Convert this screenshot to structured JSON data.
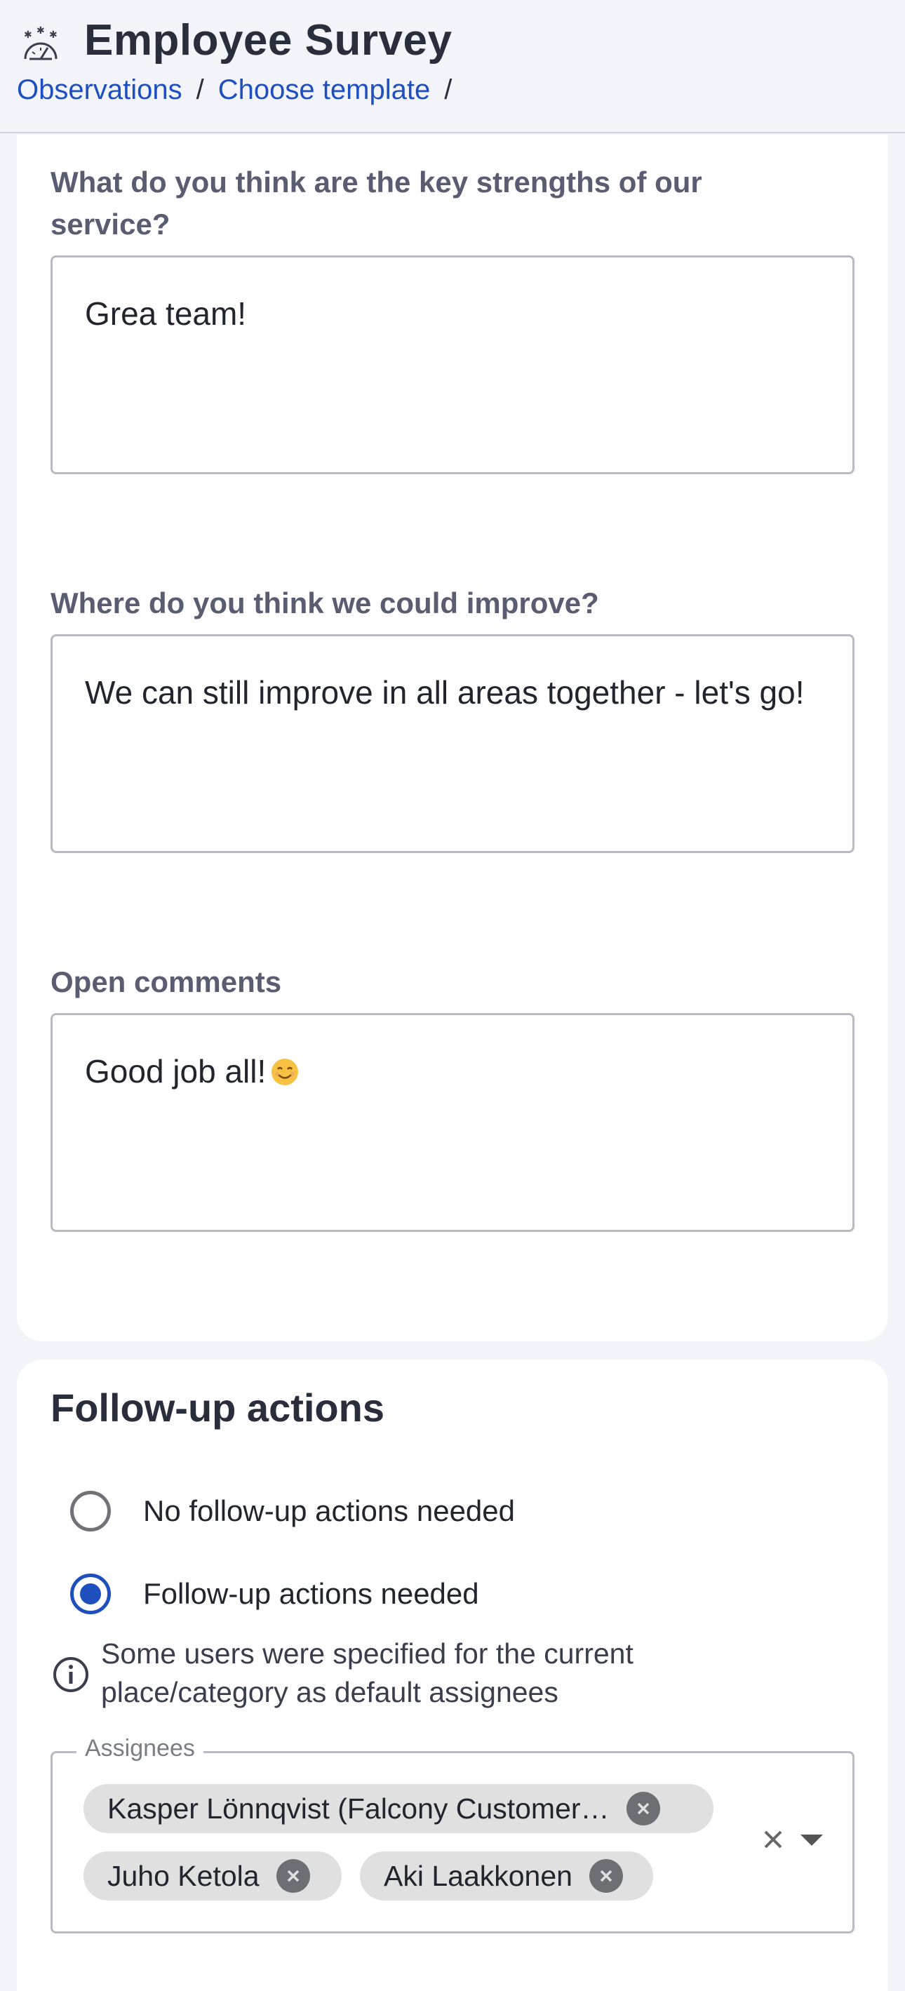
{
  "header": {
    "title": "Employee Survey",
    "breadcrumbs": [
      "Observations",
      "Choose template"
    ],
    "separator": "/"
  },
  "questions": [
    {
      "label": "What do you think are the key strengths of our service?",
      "value": "Grea team!"
    },
    {
      "label": "Where do you think we could improve?",
      "value": "We can still improve in all areas together - let's go!"
    },
    {
      "label": "Open comments",
      "value": "Good job all!"
    }
  ],
  "follow_up": {
    "title": "Follow-up actions",
    "options": [
      {
        "label": "No follow-up actions needed",
        "checked": false
      },
      {
        "label": "Follow-up actions needed",
        "checked": true
      }
    ],
    "info": "Some users were specified for the current place/category as default assignees",
    "assignees": {
      "label": "Assignees",
      "chips": [
        "Kasper Lönnqvist (Falcony Customer…",
        "Juho Ketola",
        "Aki Laakkonen"
      ]
    }
  },
  "colors": {
    "accent": "#1f4fbf",
    "background": "#f3f4f9",
    "chip": "#e0e0e0"
  }
}
